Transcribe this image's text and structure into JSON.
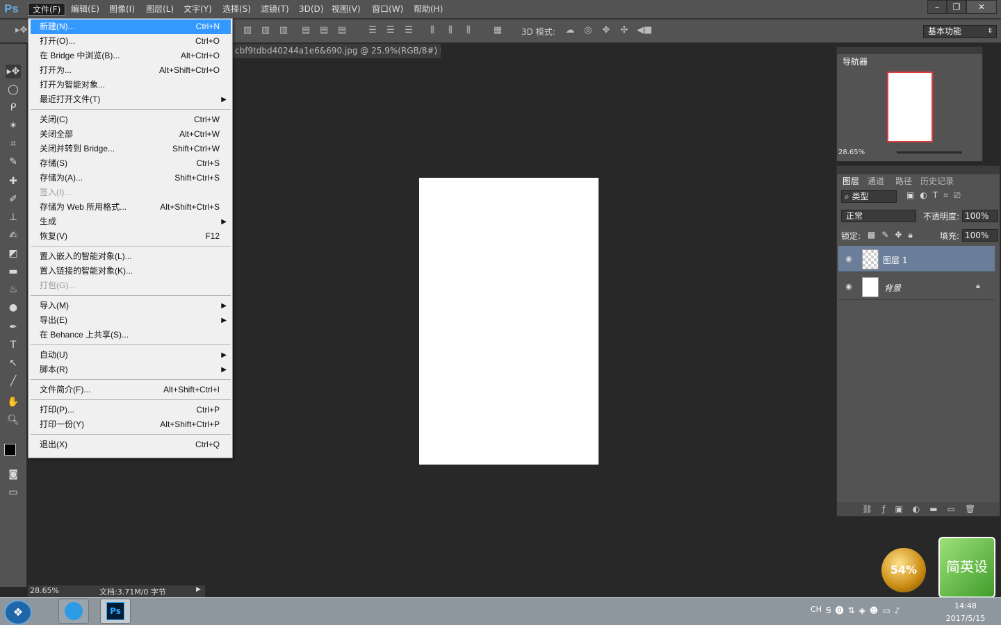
{
  "app": {
    "logo": "Ps"
  },
  "menubar": {
    "items": [
      "文件(F)",
      "编辑(E)",
      "图像(I)",
      "图层(L)",
      "文字(Y)",
      "选择(S)",
      "滤镜(T)",
      "3D(D)",
      "视图(V)",
      "窗口(W)",
      "帮助(H)"
    ],
    "active": "文件(F)"
  },
  "window_controls": {
    "minimize": "–",
    "restore": "❐",
    "close": "✕"
  },
  "options_bar": {
    "mode3d_label": "3D 模式:",
    "workspace": "基本功能"
  },
  "document_tab": {
    "title": "cbf9tdbd40244a1e6&690.jpg @ 25.9%(RGB/8#) *",
    "close": "×"
  },
  "file_menu": {
    "groups": [
      [
        {
          "label": "新建(N)...",
          "shortcut": "Ctrl+N",
          "highlight": true
        },
        {
          "label": "打开(O)...",
          "shortcut": "Ctrl+O"
        },
        {
          "label": "在 Bridge 中浏览(B)...",
          "shortcut": "Alt+Ctrl+O"
        },
        {
          "label": "打开为...",
          "shortcut": "Alt+Shift+Ctrl+O"
        },
        {
          "label": "打开为智能对象...",
          "shortcut": ""
        },
        {
          "label": "最近打开文件(T)",
          "shortcut": "",
          "submenu": true
        }
      ],
      [
        {
          "label": "关闭(C)",
          "shortcut": "Ctrl+W"
        },
        {
          "label": "关闭全部",
          "shortcut": "Alt+Ctrl+W"
        },
        {
          "label": "关闭并转到 Bridge...",
          "shortcut": "Shift+Ctrl+W"
        },
        {
          "label": "存储(S)",
          "shortcut": "Ctrl+S"
        },
        {
          "label": "存储为(A)...",
          "shortcut": "Shift+Ctrl+S"
        },
        {
          "label": "签入(I)...",
          "shortcut": "",
          "disabled": true
        },
        {
          "label": "存储为 Web 所用格式...",
          "shortcut": "Alt+Shift+Ctrl+S"
        },
        {
          "label": "生成",
          "shortcut": "",
          "submenu": true
        },
        {
          "label": "恢复(V)",
          "shortcut": "F12"
        }
      ],
      [
        {
          "label": "置入嵌入的智能对象(L)...",
          "shortcut": ""
        },
        {
          "label": "置入链接的智能对象(K)...",
          "shortcut": ""
        },
        {
          "label": "打包(G)...",
          "shortcut": "",
          "disabled": true
        }
      ],
      [
        {
          "label": "导入(M)",
          "shortcut": "",
          "submenu": true
        },
        {
          "label": "导出(E)",
          "shortcut": "",
          "submenu": true
        },
        {
          "label": "在 Behance 上共享(S)...",
          "shortcut": ""
        }
      ],
      [
        {
          "label": "自动(U)",
          "shortcut": "",
          "submenu": true
        },
        {
          "label": "脚本(R)",
          "shortcut": "",
          "submenu": true
        }
      ],
      [
        {
          "label": "文件简介(F)...",
          "shortcut": "Alt+Shift+Ctrl+I"
        }
      ],
      [
        {
          "label": "打印(P)...",
          "shortcut": "Ctrl+P"
        },
        {
          "label": "打印一份(Y)",
          "shortcut": "Alt+Shift+Ctrl+P"
        }
      ],
      [
        {
          "label": "退出(X)",
          "shortcut": "Ctrl+Q"
        }
      ]
    ]
  },
  "navigator": {
    "title": "导航器",
    "zoom": "28.65%"
  },
  "layers_panel": {
    "tabs": [
      "图层",
      "通道",
      "路径",
      "历史记录"
    ],
    "filter_kind": "类型",
    "blend_mode": "正常",
    "opacity_label": "不透明度:",
    "opacity": "100%",
    "lock_label": "锁定:",
    "fill_label": "填充:",
    "fill": "100%",
    "layers": [
      {
        "name": "图层 1",
        "selected": true,
        "transparent": true,
        "locked": false
      },
      {
        "name": "背景",
        "selected": false,
        "transparent": false,
        "locked": true
      }
    ]
  },
  "status_bar": {
    "zoom": "28.65%",
    "doc_info": "文档:3.71M/0 字节"
  },
  "taskbar": {
    "ime": "CH",
    "time": "14:48",
    "date": "2017/5/15"
  },
  "ads": {
    "orb_text": "54%",
    "green_text": "简英设"
  },
  "colors": {
    "menu_highlight": "#3399ff",
    "ui_bg": "#535353",
    "workspace_bg": "#282828"
  }
}
